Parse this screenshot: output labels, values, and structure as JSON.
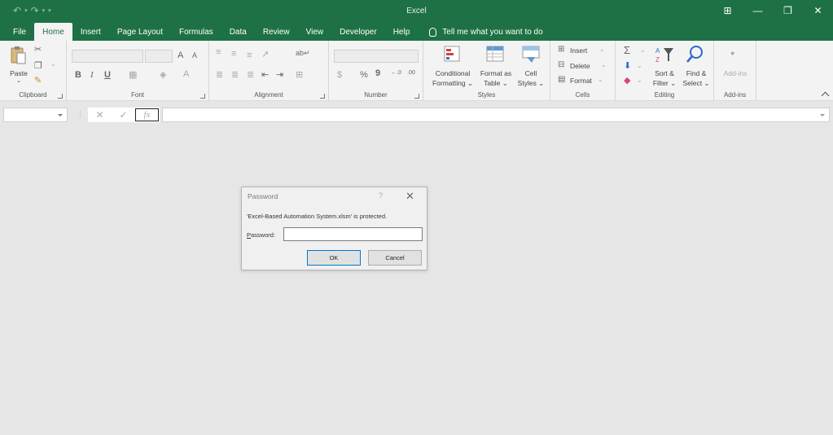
{
  "window": {
    "title": "Excel",
    "controls": {
      "ribbon_display": "⊞",
      "minimize": "—",
      "restore": "❐",
      "close": "✕"
    }
  },
  "qat": {
    "undo": "↶",
    "redo": "↷",
    "customize": "▾"
  },
  "tabs": [
    {
      "label": "File"
    },
    {
      "label": "Home",
      "active": true
    },
    {
      "label": "Insert"
    },
    {
      "label": "Page Layout"
    },
    {
      "label": "Formulas"
    },
    {
      "label": "Data"
    },
    {
      "label": "Review"
    },
    {
      "label": "View"
    },
    {
      "label": "Developer"
    },
    {
      "label": "Help"
    }
  ],
  "tell_me": {
    "placeholder": "Tell me what you want to do"
  },
  "ribbon": {
    "clipboard": {
      "label": "Clipboard",
      "paste_line1": "Paste",
      "paste_line2": "⌄"
    },
    "font": {
      "label": "Font",
      "bold": "B",
      "italic": "I",
      "underline": "U",
      "grow": "A",
      "shrink": "A"
    },
    "alignment": {
      "label": "Alignment"
    },
    "number": {
      "label": "Number",
      "currency": "$",
      "percent": "%",
      "comma": "9",
      "inc_dec": "←.0",
      "dec_dec": ".00"
    },
    "styles": {
      "label": "Styles",
      "conditional_line1": "Conditional",
      "conditional_line2": "Formatting ⌄",
      "format_table_line1": "Format as",
      "format_table_line2": "Table ⌄",
      "cell_styles_line1": "Cell",
      "cell_styles_line2": "Styles ⌄"
    },
    "cells": {
      "label": "Cells",
      "insert": "Insert",
      "delete": "Delete",
      "format": "Format"
    },
    "editing": {
      "label": "Editing",
      "sort_line1": "Sort &",
      "sort_line2": "Filter ⌄",
      "find_line1": "Find &",
      "find_line2": "Select ⌄",
      "sum": "Σ"
    },
    "addins": {
      "label": "Add-ins",
      "button": "Add-ins"
    }
  },
  "formula_bar": {
    "cancel": "✕",
    "enter": "✓",
    "fx": "fx"
  },
  "dialog": {
    "title": "Password",
    "help": "?",
    "close": "✕",
    "message": "'Excel-Based Automation System.xlsm' is protected.",
    "password_label_accel": "P",
    "password_label_rest": "assword:",
    "ok": "OK",
    "cancel": "Cancel"
  }
}
